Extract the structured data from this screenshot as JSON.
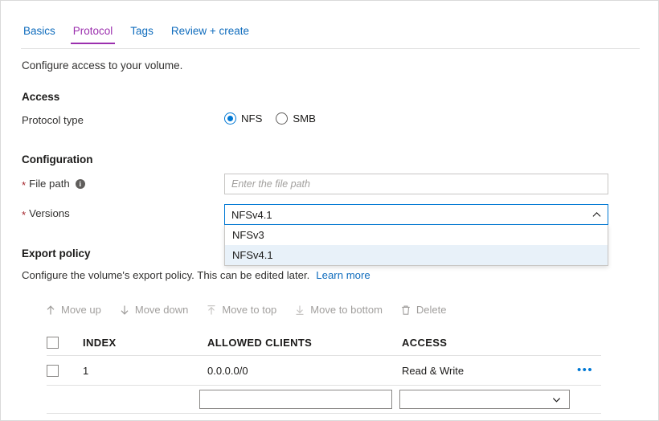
{
  "tabs": [
    {
      "label": "Basics",
      "active": false
    },
    {
      "label": "Protocol",
      "active": true
    },
    {
      "label": "Tags",
      "active": false
    },
    {
      "label": "Review + create",
      "active": false
    }
  ],
  "intro": "Configure access to your volume.",
  "access": {
    "heading": "Access",
    "protocol_label": "Protocol type",
    "options": [
      {
        "label": "NFS",
        "selected": true
      },
      {
        "label": "SMB",
        "selected": false
      }
    ]
  },
  "configuration": {
    "heading": "Configuration",
    "file_path": {
      "label": "File path",
      "required": "*",
      "info_icon": "info-icon",
      "value": "",
      "placeholder": "Enter the file path"
    },
    "versions": {
      "label": "Versions",
      "required": "*",
      "value": "NFSv4.1",
      "expanded": true,
      "chevron_icon": "chevron-up-icon",
      "options": [
        {
          "label": "NFSv3",
          "selected": false
        },
        {
          "label": "NFSv4.1",
          "selected": true
        }
      ]
    }
  },
  "export_policy": {
    "heading": "Export policy",
    "description": "Configure the volume's export policy. This can be edited later.",
    "learn_more": "Learn more",
    "toolbar": [
      {
        "label": "Move up",
        "icon": "arrow-up-icon",
        "disabled": true
      },
      {
        "label": "Move down",
        "icon": "arrow-down-icon",
        "disabled": true
      },
      {
        "label": "Move to top",
        "icon": "arrow-to-top-icon",
        "disabled": true
      },
      {
        "label": "Move to bottom",
        "icon": "arrow-to-bottom-icon",
        "disabled": true
      },
      {
        "label": "Delete",
        "icon": "trash-icon",
        "disabled": true
      }
    ],
    "table": {
      "columns": [
        "INDEX",
        "ALLOWED CLIENTS",
        "ACCESS"
      ],
      "rows": [
        {
          "index": "1",
          "allowed_clients": "0.0.0.0/0",
          "access": "Read & Write",
          "menu_icon": "ellipsis-icon"
        }
      ],
      "new_row": {
        "allowed_clients_value": "",
        "access_value": "",
        "access_chevron": "chevron-down-icon"
      }
    }
  },
  "colors": {
    "link": "#0f6cbd",
    "tab_active": "#9b2fae",
    "accent": "#0078d4",
    "required": "#a4262c",
    "disabled_text": "#a19f9d",
    "dropdown_selected_bg": "#e8f1f9"
  }
}
